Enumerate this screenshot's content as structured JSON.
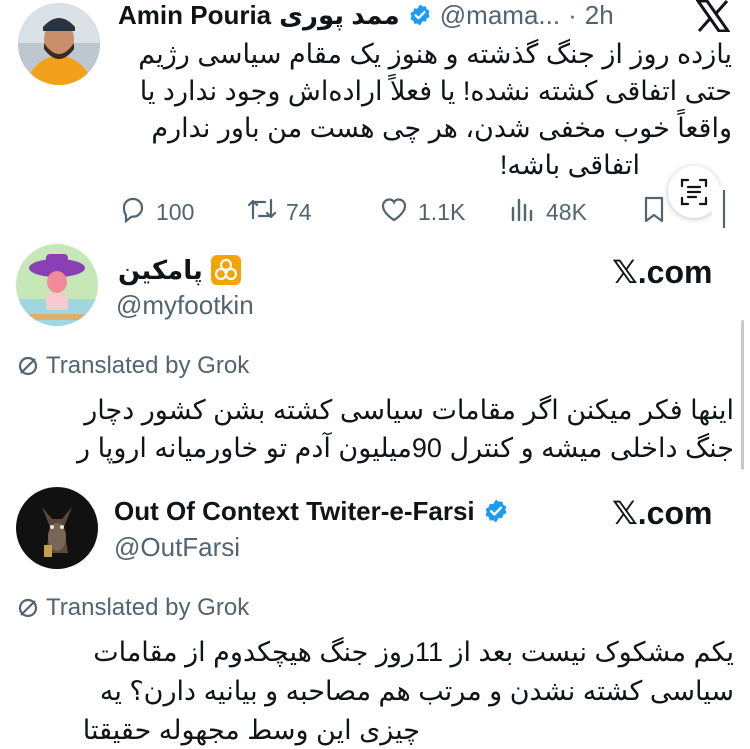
{
  "tweet1": {
    "display_name": "Amin Pouria",
    "display_name_fa": "ممد پوری",
    "handle": "@mama...",
    "time_sep": "·",
    "time": "2h",
    "lines": [
      "یازده روز از جنگ گذشته و هنوز یک مقام سیاسی رژیم",
      "حتی اتفاقی کشته نشده! یا فعلاً اراده‌اش وجود ندارد یا",
      "واقعاً خوب مخفی شدن، هر چی هست من باور ندارم",
      "اتفاقی باشه!"
    ],
    "stats": {
      "replies": "100",
      "reposts": "74",
      "likes": "1.1K",
      "views": "48K"
    }
  },
  "card1": {
    "display_name": "پامکین",
    "handle": "@myfootkin",
    "site": ".com",
    "translated_label": "Translated by Grok",
    "lines": [
      "اینها فکر میکنن اگر مقامات سیاسی کشته بشن کشور دچار",
      "جنگ داخلی میشه و کنترل 90میلیون آدم تو خاورمیانه اروپا ر"
    ]
  },
  "card2": {
    "display_name": "Out Of Context Twiter-e-Farsi",
    "handle": "@OutFarsi",
    "site": ".com",
    "translated_label": "Translated by Grok",
    "lines": [
      "یکم مشکوک نیست بعد از 11روز جنگ هیچکدوم از مقامات",
      "سیاسی کشته نشدن و مرتب هم مصاحبه و بیانیه دارن؟ یه",
      "چیزی این وسط مجهوله حقیقتا"
    ]
  },
  "colors": {
    "text": "#0f1419",
    "secondary": "#536471",
    "verified": "#1d9bf0",
    "biohazard": "#f4a300"
  },
  "icons": [
    "x-logo-icon",
    "verified-badge-icon",
    "reply-icon",
    "repost-icon",
    "like-icon",
    "views-icon",
    "bookmark-icon",
    "text-recognition-icon",
    "biohazard-icon",
    "translate-icon"
  ]
}
